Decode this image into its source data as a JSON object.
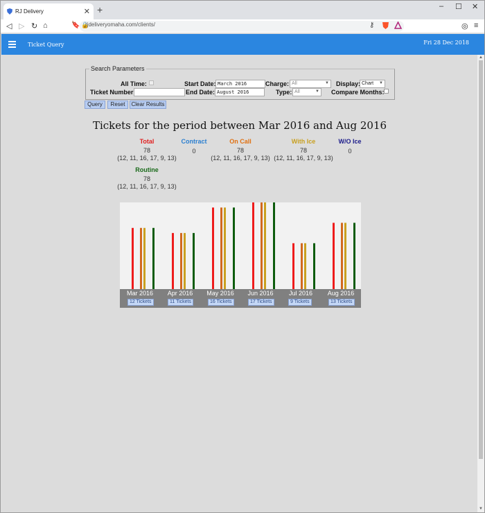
{
  "browser": {
    "tab_title": "RJ Delivery",
    "new_tab_icon": "plus-icon",
    "url": "rjdeliveryomaha.com/clients/",
    "window_controls": [
      "minimize-icon",
      "maximize-icon",
      "close-icon"
    ]
  },
  "app": {
    "title": "Ticket Query",
    "date": "Fri 28 Dec 2018",
    "header_color": "#2b86e0"
  },
  "params": {
    "legend": "Search Parameters",
    "all_time_label": "All Time:",
    "ticket_number_label": "Ticket Number:",
    "ticket_number_value": "",
    "start_date_label": "Start Date:",
    "start_date_value": "March 2016",
    "end_date_label": "End Date:",
    "end_date_value": "August 2016",
    "charge_label": "Charge:",
    "charge_value": "All",
    "type_label": "Type:",
    "type_value": "All",
    "display_label": "Display:",
    "display_value": "Chart",
    "compare_label": "Compare Months:"
  },
  "buttons": {
    "query": "Query",
    "reset": "Reset",
    "clear": "Clear Results"
  },
  "summary": {
    "heading": "Tickets for the period between Mar 2016 and Aug 2016",
    "total": {
      "label": "Total",
      "count": "78",
      "detail": "(12, 11, 16, 17, 9, 13)",
      "color": "#e02020"
    },
    "contract": {
      "label": "Contract",
      "count": "0",
      "color": "#2b86e0"
    },
    "on_call": {
      "label": "On Call",
      "count": "78",
      "detail": "(12, 11, 16, 17, 9, 13)",
      "color": "#e07010"
    },
    "with_ice": {
      "label": "With Ice",
      "count": "78",
      "detail": "(12, 11, 16, 17, 9, 13)",
      "color": "#c9a020"
    },
    "wo_ice": {
      "label": "W/O Ice",
      "count": "0",
      "color": "#1a1a8a"
    },
    "routine": {
      "label": "Routine",
      "count": "78",
      "detail": "(12, 11, 16, 17, 9, 13)",
      "color": "#1a6a1a"
    }
  },
  "chart_data": {
    "type": "bar",
    "categories": [
      "Mar 2016",
      "Apr 2016",
      "May 2016",
      "Jun 2016",
      "Jul 2016",
      "Aug 2016"
    ],
    "badges": [
      "12 Tickets",
      "11 Tickets",
      "16 Tickets",
      "17 Tickets",
      "9 Tickets",
      "13 Tickets"
    ],
    "series": [
      {
        "values": [
          12,
          11,
          16,
          17,
          9,
          13
        ],
        "color": "#ee1c1c"
      },
      {
        "values": [
          0,
          0,
          0,
          0,
          0,
          0
        ],
        "color": "#2b86e0"
      },
      {
        "values": [
          12,
          11,
          16,
          17,
          9,
          13
        ],
        "color": "#d2691e"
      },
      {
        "values": [
          12,
          11,
          16,
          17,
          9,
          13
        ],
        "color": "#c9a020"
      },
      {
        "values": [
          0,
          0,
          0,
          0,
          0,
          0
        ],
        "color": "#1a1a8a"
      },
      {
        "values": [
          12,
          11,
          16,
          17,
          9,
          13
        ],
        "color": "#0d5c0d"
      }
    ],
    "ylim": [
      0,
      17
    ]
  }
}
